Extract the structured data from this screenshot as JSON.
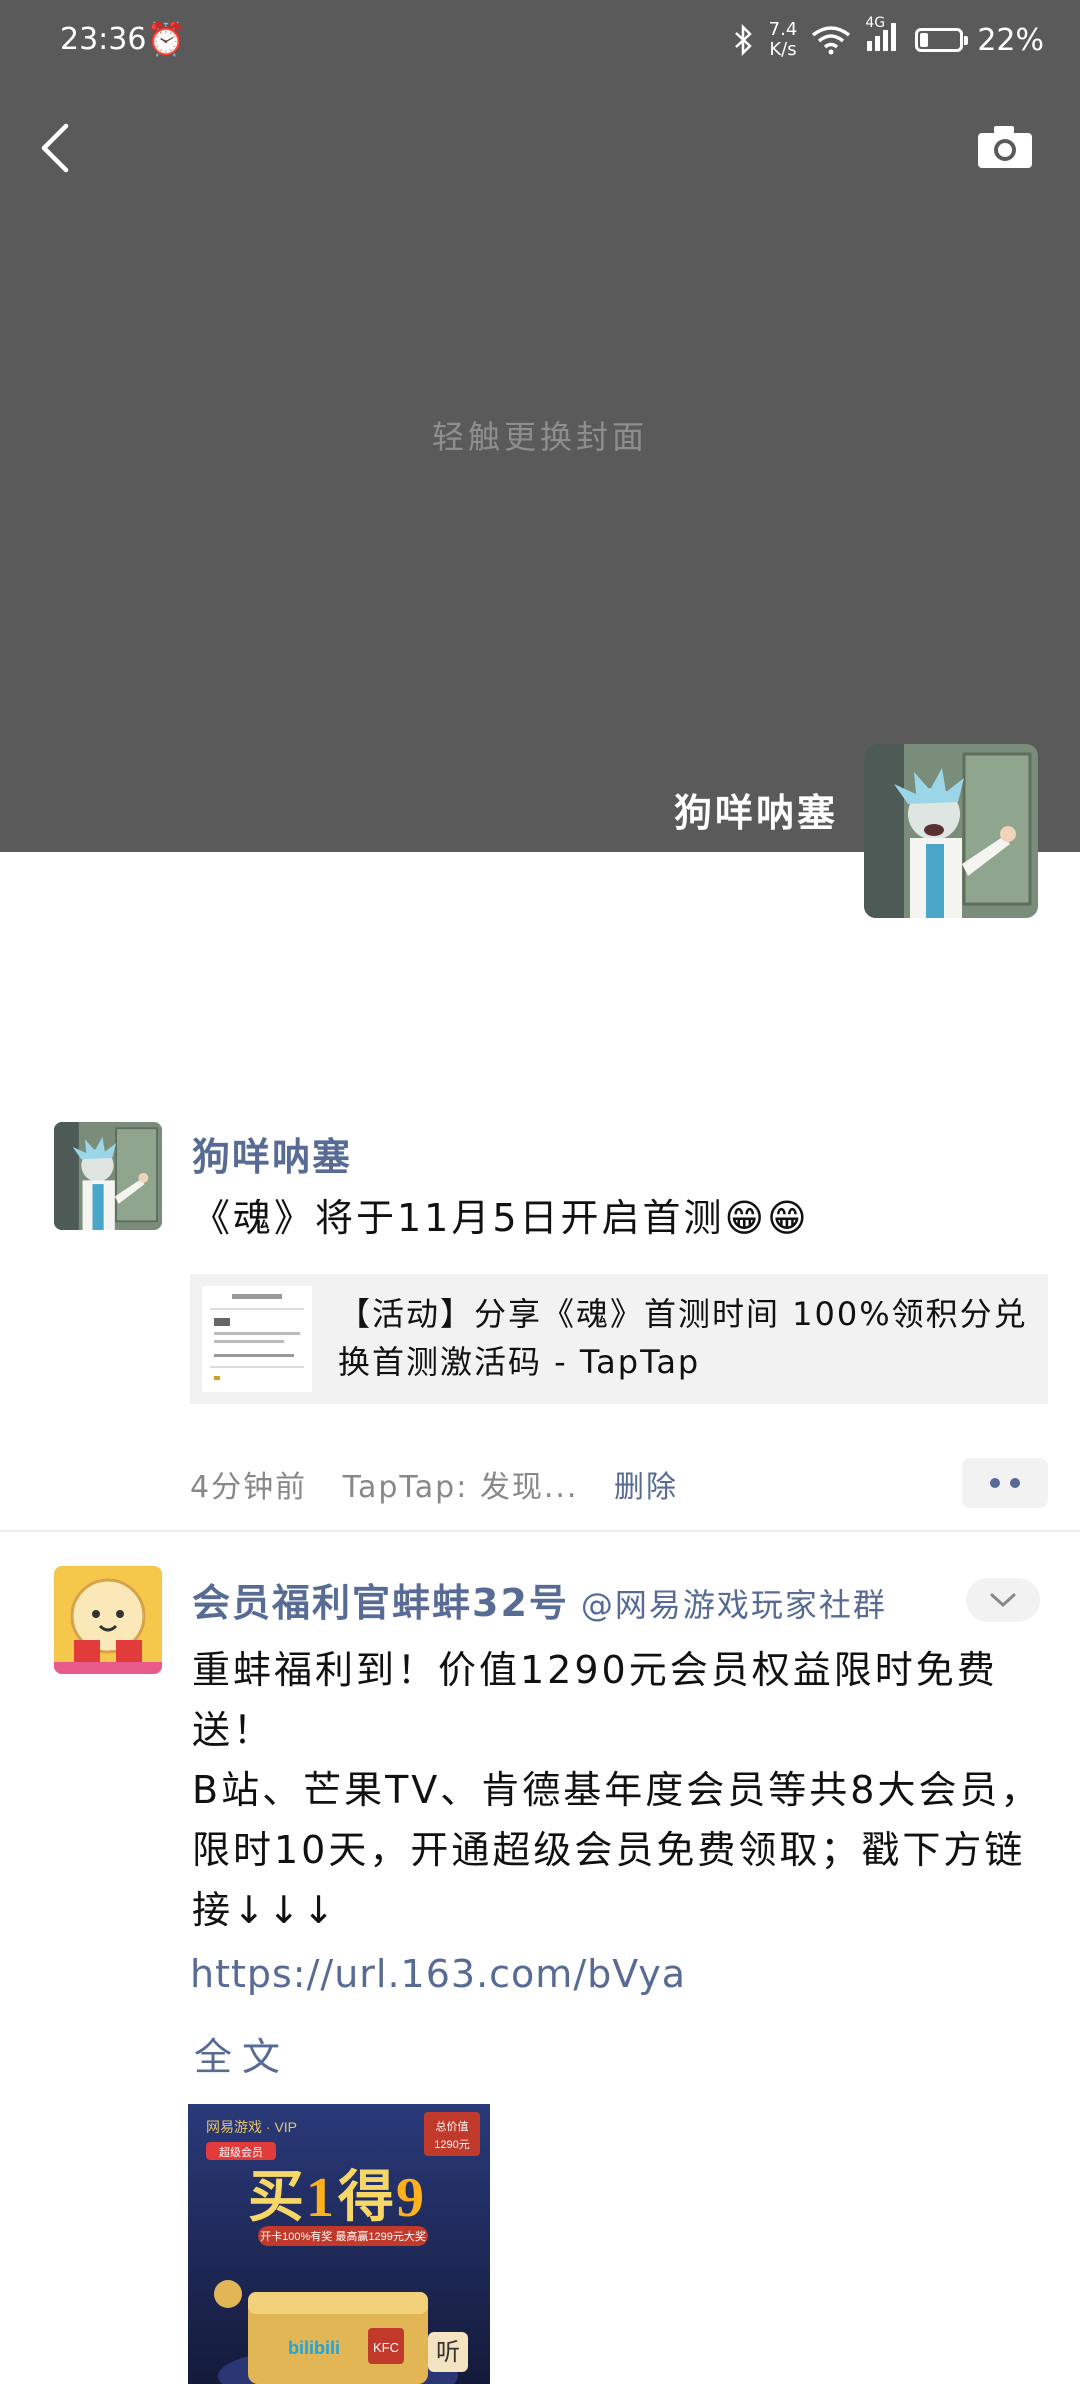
{
  "status_bar": {
    "time": "23:36",
    "speed_value": "7.4",
    "speed_unit": "K/s",
    "network": "4G",
    "battery_percent": "22%",
    "battery_level": 0.22
  },
  "cover": {
    "hint": "轻触更换封面"
  },
  "profile": {
    "name": "狗咩呐塞"
  },
  "posts": [
    {
      "author": "狗咩呐塞",
      "text": "《魂》将于11月5日开启首测😁😁",
      "link_title": "【活动】分享《魂》首测时间 100%领积分兑换首测激活码 - TapTap",
      "time": "4分钟前",
      "source": "TapTap: 发现...",
      "delete_label": "删除"
    },
    {
      "author": "会员福利官蚌蚌32号",
      "community": "@网易游戏玩家社群",
      "text_line1": "重蚌福利到！价值1290元会员权益限时免费送！",
      "text_line2": "B站、芒果TV、肯德基年度会员等共8大会员，限时10天，开通超级会员免费领取；戳下方链接↓↓↓",
      "link": "https://url.163.com/bVya",
      "fulltext_label": "全文",
      "promo": {
        "brand": "网易游戏 · VIP",
        "headline_a": "买",
        "headline_num1": "1",
        "headline_b": "得",
        "headline_num2": "9",
        "badge_line1": "总价值",
        "badge_line2": "1290元",
        "sub": "开卡100%有奖 最高赢1299元大奖",
        "tag": "超级会员",
        "bili": "bilibili",
        "ting": "听"
      }
    }
  ]
}
